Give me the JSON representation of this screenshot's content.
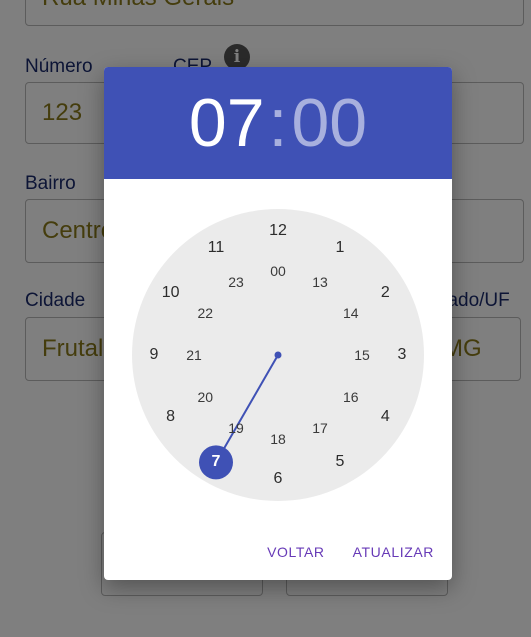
{
  "form": {
    "street_value": "Rua Minas Gerais",
    "number_label": "Número",
    "number_value": "123",
    "cep_label": "CEP",
    "info_icon": "info-icon",
    "neighborhood_label": "Bairro",
    "neighborhood_value": "Centro",
    "city_label": "Cidade",
    "city_value": "Frutal",
    "state_label": "Estado/UF",
    "state_value": "MG"
  },
  "picker": {
    "hour": "07",
    "separator": ":",
    "minute": "00",
    "selected_hour": 7,
    "outer_numbers": [
      "12",
      "1",
      "2",
      "3",
      "4",
      "5",
      "6",
      "7",
      "8",
      "9",
      "10",
      "11"
    ],
    "inner_numbers": [
      "00",
      "13",
      "14",
      "15",
      "16",
      "17",
      "18",
      "19",
      "20",
      "21",
      "22",
      "23"
    ],
    "colors": {
      "header": "#3f51b5",
      "accent": "#3f51b5",
      "button_text": "#673ab7"
    },
    "buttons": {
      "cancel": "VOLTAR",
      "confirm": "ATUALIZAR"
    }
  }
}
